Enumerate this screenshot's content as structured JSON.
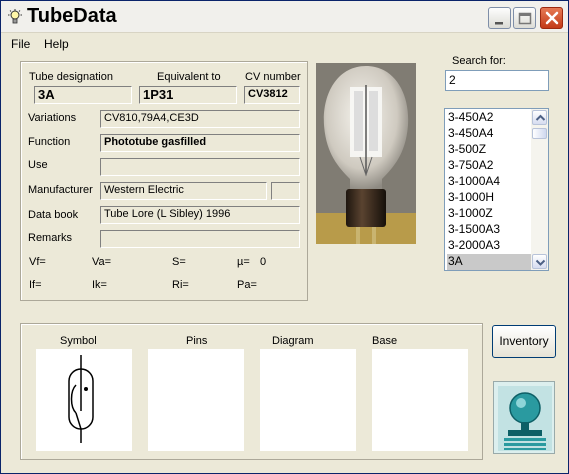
{
  "app": {
    "title": "TubeData"
  },
  "menu": {
    "file": "File",
    "help": "Help"
  },
  "form": {
    "tube_designation_label": "Tube designation",
    "tube_designation": "3A",
    "equivalent_label": "Equivalent to",
    "equivalent": "1P31",
    "cv_label": "CV number",
    "cv": "CV3812",
    "variations_label": "Variations",
    "variations": "CV810,79A4,CE3D",
    "function_label": "Function",
    "function": "Phototube gasfilled",
    "use_label": "Use",
    "use": "",
    "manufacturer_label": "Manufacturer",
    "manufacturer": "Western Electric",
    "manufacturer_extra": "",
    "databook_label": "Data book",
    "databook": "Tube Lore (L Sibley) 1996",
    "remarks_label": "Remarks",
    "remarks": ""
  },
  "params": {
    "vf": "Vf=",
    "va": "Va=",
    "s": "S=",
    "mu": "µ=",
    "mu_value": "0",
    "if": "If=",
    "ik": "Ik=",
    "ri": "Ri=",
    "pa": "Pa="
  },
  "search": {
    "label": "Search for:",
    "value": "2",
    "results": [
      "3-450A2",
      "3-450A4",
      "3-500Z",
      "3-750A2",
      "3-1000A4",
      "3-1000H",
      "3-1000Z",
      "3-1500A3",
      "3-2000A3",
      "3A"
    ],
    "selected": "3A"
  },
  "panes": {
    "symbol": "Symbol",
    "pins": "Pins",
    "diagram": "Diagram",
    "base": "Base"
  },
  "inventory_button": "Inventory",
  "icons": {
    "app": "lightbulb-icon",
    "minimize": "minimize-icon",
    "maximize": "maximize-icon",
    "close": "close-icon",
    "scroll_up": "arrow-up-icon",
    "scroll_down": "arrow-down-icon"
  },
  "colors": {
    "title_close": "#c33a17",
    "selection": "#c9c9c9",
    "list_border": "#7f9db9"
  }
}
